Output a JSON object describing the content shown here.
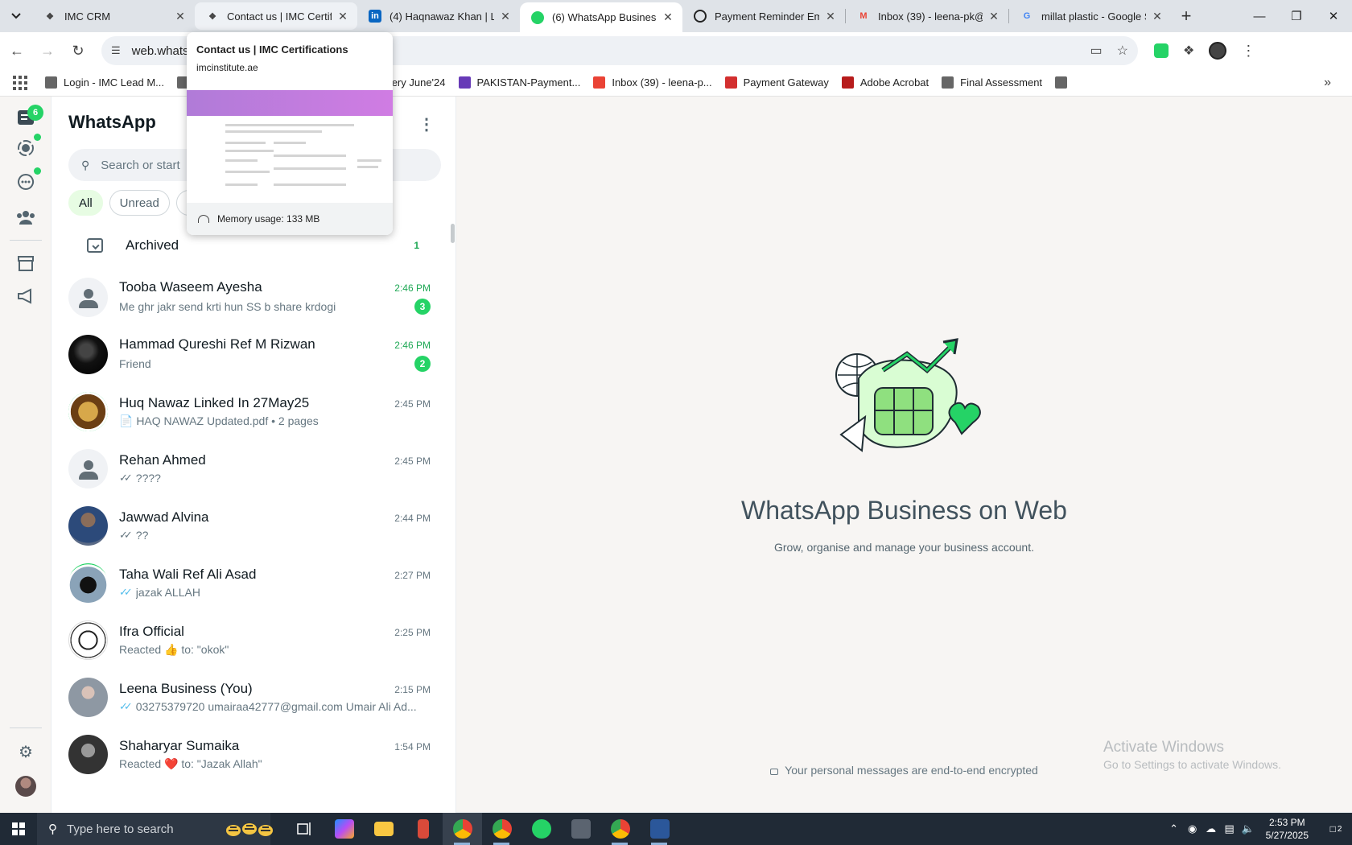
{
  "browser": {
    "tabs": [
      {
        "title": "IMC CRM",
        "icon": "imc-favicon",
        "state": "normal"
      },
      {
        "title": "Contact us | IMC Certifica",
        "icon": "imc-favicon",
        "state": "hovered"
      },
      {
        "title": "(4) Haqnawaz Khan | Link",
        "icon": "linkedin-favicon",
        "state": "normal"
      },
      {
        "title": "(6) WhatsApp Business",
        "icon": "whatsapp-favicon",
        "state": "active"
      },
      {
        "title": "Payment Reminder Emai",
        "icon": "openai-favicon",
        "state": "normal"
      },
      {
        "title": "Inbox (39) - leena-pk@im",
        "icon": "gmail-favicon",
        "state": "normal"
      },
      {
        "title": "millat plastic - Google Se",
        "icon": "google-favicon",
        "state": "normal"
      }
    ],
    "new_tab_label": "+",
    "url": "web.whatsapp",
    "bookmarks": [
      {
        "label": "Login - IMC Lead M...",
        "color": "#666666"
      },
      {
        "label": "",
        "color": "#666666"
      },
      {
        "label": "PAKISTAN-Payment...",
        "color": "#673ab7"
      },
      {
        "label": "Recovery June'24",
        "color": "#0f9d58"
      },
      {
        "label": "PAKISTAN-Payment...",
        "color": "#673ab7"
      },
      {
        "label": "Inbox (39) - leena-p...",
        "color": "#ea4335"
      },
      {
        "label": "Payment Gateway",
        "color": "#d32f2f"
      },
      {
        "label": "Adobe Acrobat",
        "color": "#b71c1c"
      },
      {
        "label": "Final Assessment",
        "color": "#666666"
      },
      {
        "label": "",
        "color": "#666666"
      }
    ]
  },
  "hovercard": {
    "title": "Contact us | IMC Certifications",
    "domain": "imcinstitute.ae",
    "memory": "Memory usage: 133 MB"
  },
  "whatsapp": {
    "app_title": "WhatsApp",
    "rail": {
      "chats_badge": "6"
    },
    "search_placeholder": "Search or start",
    "filters": [
      "All",
      "Unread",
      "F"
    ],
    "archived": {
      "label": "Archived",
      "count": "1"
    },
    "chats": [
      {
        "name": "Tooba Waseem Ayesha",
        "time": "2:46 PM",
        "preview": "Me ghr jakr send krti hun SS b share krdogi",
        "unread": "3",
        "ticks": "",
        "avatar": "placeholder"
      },
      {
        "name": "Hammad Qureshi Ref M Rizwan",
        "time": "2:46 PM",
        "preview": "Friend",
        "unread": "2",
        "ticks": "",
        "avatar": "photo-dark"
      },
      {
        "name": "Huq Nawaz Linked In 27May25",
        "time": "2:45 PM",
        "preview": "📄 HAQ NAWAZ Updated.pdf • 2 pages",
        "unread": "",
        "ticks": "",
        "avatar": "photo-ring-gold"
      },
      {
        "name": "Rehan Ahmed",
        "time": "2:45 PM",
        "preview": "????",
        "unread": "",
        "ticks": "sent",
        "avatar": "placeholder"
      },
      {
        "name": "Jawwad Alvina",
        "time": "2:44 PM",
        "preview": "??",
        "unread": "",
        "ticks": "sent",
        "avatar": "photo-blue"
      },
      {
        "name": "Taha Wali Ref Ali Asad",
        "time": "2:27 PM",
        "preview": "jazak ALLAH",
        "unread": "",
        "ticks": "read",
        "avatar": "photo-ring-kaaba"
      },
      {
        "name": "Ifra Official",
        "time": "2:25 PM",
        "preview": "Reacted 👍 to: \"okok\"",
        "unread": "",
        "ticks": "",
        "avatar": "logo-imc"
      },
      {
        "name": "Leena Business (You)",
        "time": "2:15 PM",
        "preview": "03275379720  umairaa42777@gmail.com  Umair Ali Ad...",
        "unread": "",
        "ticks": "read",
        "avatar": "photo-grey"
      },
      {
        "name": "Shaharyar Sumaika",
        "time": "1:54 PM",
        "preview": "Reacted ❤️ to: \"Jazak Allah\"",
        "unread": "",
        "ticks": "",
        "avatar": "photo-bw"
      }
    ],
    "main": {
      "title": "WhatsApp Business on Web",
      "subtitle": "Grow, organise and manage your business account.",
      "encryption": "Your personal messages are end-to-end encrypted"
    }
  },
  "watermark": {
    "line1": "Activate Windows",
    "line2": "Go to Settings to activate Windows."
  },
  "taskbar": {
    "search_placeholder": "Type here to search",
    "time": "2:53 PM",
    "date": "5/27/2025",
    "notifications": "2"
  }
}
